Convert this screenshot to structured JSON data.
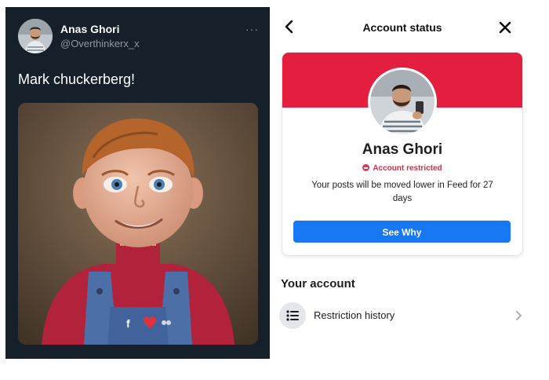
{
  "tweet": {
    "display_name": "Anas Ghori",
    "handle": "@Overthinkerx_x",
    "more_icon": "···",
    "text": "Mark chuckerberg!",
    "photo_icon": "photo-image"
  },
  "account_status": {
    "title": "Account status",
    "profile": {
      "name": "Anas Ghori",
      "status_label": "Account restricted",
      "description": "Your posts will be moved lower in Feed for 27 days"
    },
    "see_why_label": "See Why",
    "section_title": "Your account",
    "restriction_history_label": "Restriction history",
    "colors": {
      "banner": "#e41e3f",
      "button": "#1877f2",
      "restricted_text": "#c3334b"
    }
  }
}
